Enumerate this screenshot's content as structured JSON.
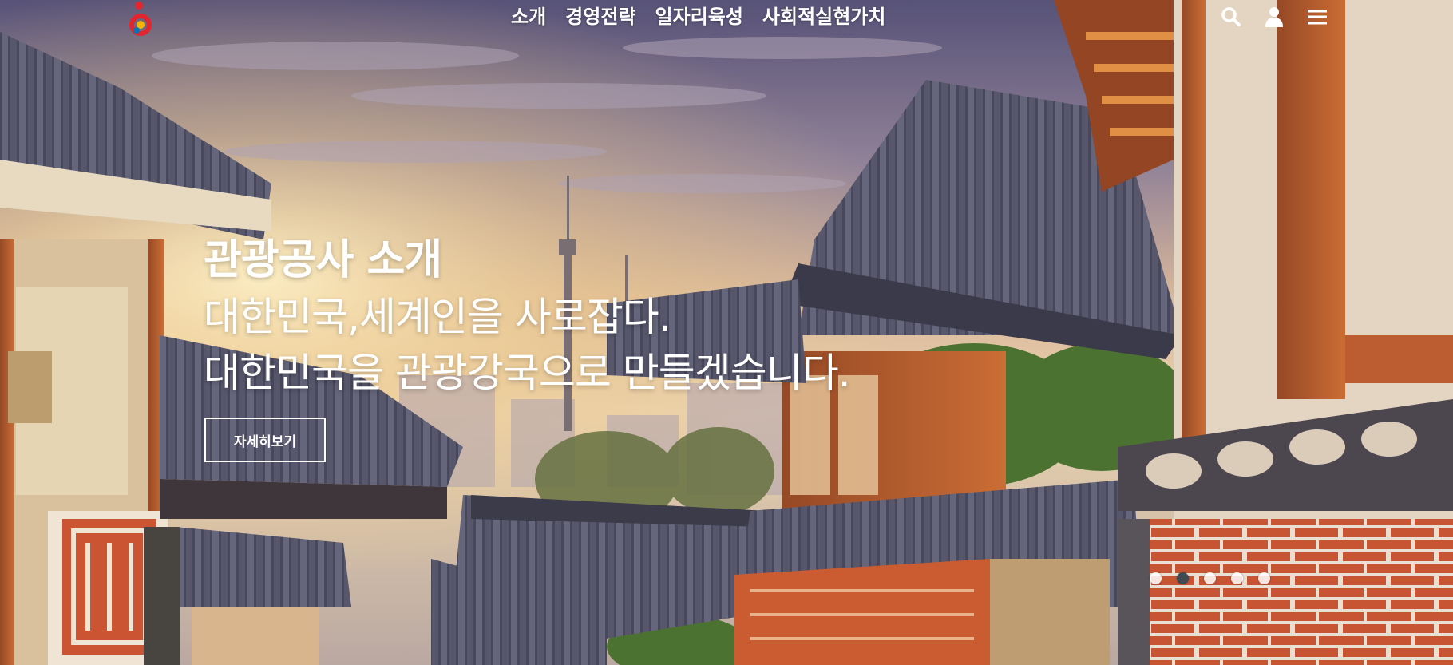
{
  "nav": {
    "items": [
      {
        "label": "소개"
      },
      {
        "label": "경영전략"
      },
      {
        "label": "일자리육성"
      },
      {
        "label": "사회적실현가치"
      }
    ]
  },
  "utility": {
    "search_icon": "search-icon",
    "user_icon": "user-icon",
    "menu_icon": "hamburger-menu-icon"
  },
  "hero": {
    "title": "관광공사 소개",
    "line1": "대한민국,세계인을 사로잡다.",
    "line2": "대한민국을 관광강국으로 만들겠습니다.",
    "more_label": "자세히보기"
  },
  "slider": {
    "count": 5,
    "active_index": 1
  },
  "colors": {
    "sky_top": "#3a3a6a",
    "sky_glow": "#f3d7a0",
    "roof_tile": "#3b3f5a",
    "wood": "#b2552a",
    "pager_active": "#3f4a52"
  }
}
